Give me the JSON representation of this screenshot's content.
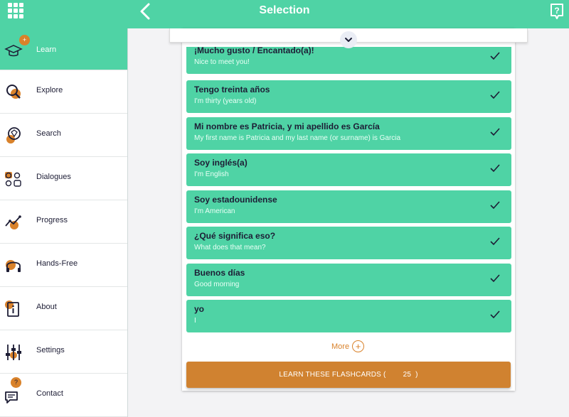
{
  "header": {
    "title": "Selection"
  },
  "sidebar": {
    "items": [
      {
        "label": "Learn",
        "badge": "+"
      },
      {
        "label": "Explore"
      },
      {
        "label": "Search"
      },
      {
        "label": "Dialogues"
      },
      {
        "label": "Progress"
      },
      {
        "label": "Hands-Free"
      },
      {
        "label": "About"
      },
      {
        "label": "Settings"
      },
      {
        "label": "Contact",
        "badge": "?"
      }
    ]
  },
  "phrases": [
    {
      "es": "¡Mucho gusto / Encantado(a)!",
      "en": "Nice to meet you!"
    },
    {
      "es": "Tengo treinta años",
      "en": "I'm thirty (years old)"
    },
    {
      "es": "Mi nombre es Patricia, y mi apellido es García",
      "en": "My first name is Patricia and my last name (or surname) is Garcia"
    },
    {
      "es": "Soy inglés(a)",
      "en": "I'm English"
    },
    {
      "es": "Soy estadounidense",
      "en": "I'm American"
    },
    {
      "es": "¿Qué significa eso?",
      "en": "What does that mean?"
    },
    {
      "es": "Buenos días",
      "en": "Good morning"
    },
    {
      "es": "yo",
      "en": "I"
    }
  ],
  "more": {
    "label": "More",
    "icon": "+"
  },
  "learn": {
    "prefix": "LEARN THESE FLASHCARDS (",
    "count": "25",
    "suffix": ")"
  },
  "colors": {
    "accent": "#4fd3a5",
    "orange": "#d08230",
    "text": "#1d1d35"
  }
}
